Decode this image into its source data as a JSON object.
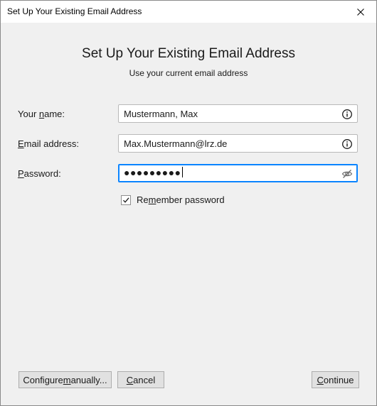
{
  "window": {
    "title": "Set Up Your Existing Email Address"
  },
  "header": {
    "title": "Set Up Your Existing Email Address",
    "subtitle": "Use your current email address"
  },
  "form": {
    "name": {
      "label_pre": "Your ",
      "label_key": "n",
      "label_post": "ame:",
      "value": "Mustermann, Max",
      "icon": "info-icon"
    },
    "email": {
      "label_pre": "",
      "label_key": "E",
      "label_post": "mail address:",
      "value": "Max.Mustermann@lrz.de",
      "icon": "info-icon"
    },
    "password": {
      "label_pre": "",
      "label_key": "P",
      "label_post": "assword:",
      "value": "●●●●●●●●●",
      "icon": "eye-hidden-icon"
    },
    "remember": {
      "label_pre": "Re",
      "label_key": "m",
      "label_post": "ember password",
      "checked": true
    }
  },
  "buttons": {
    "configure": {
      "pre": "Configure ",
      "key": "m",
      "post": "anually..."
    },
    "cancel": {
      "pre": "",
      "key": "C",
      "post": "ancel"
    },
    "continue": {
      "pre": "",
      "key": "C",
      "post": "ontinue"
    }
  },
  "colors": {
    "accent": "#0a84ff",
    "background": "#f0f0f0"
  }
}
